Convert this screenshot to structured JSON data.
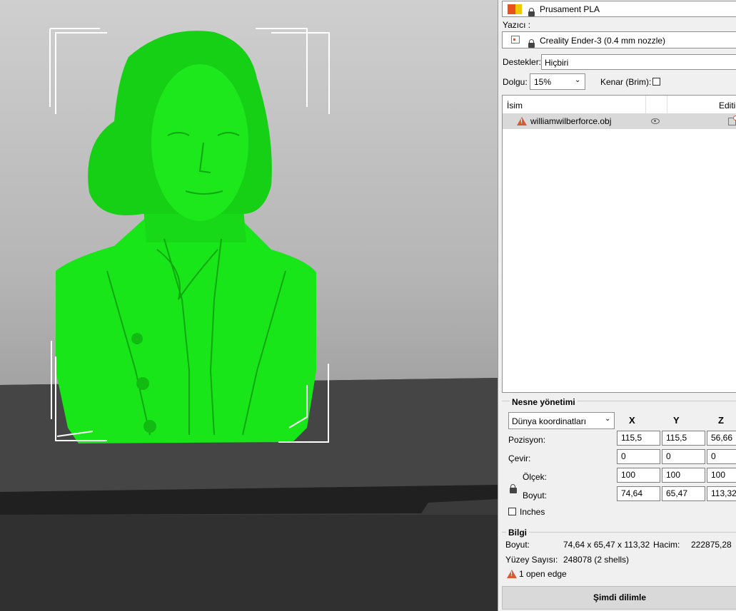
{
  "material": {
    "label": "Prusament PLA",
    "swatch_colors": [
      "#e8511c",
      "#f0c800"
    ],
    "icon": "lock-icon"
  },
  "printer": {
    "section_label": "Yazıcı :",
    "value": "Creality Ender-3 (0.4 mm nozzle)",
    "icon": "printer-icon"
  },
  "supports": {
    "label": "Destekler:",
    "value": "Hiçbiri"
  },
  "infill": {
    "label": "Dolgu:",
    "value": "15%"
  },
  "brim": {
    "label": "Kenar (Brim):",
    "checked": false
  },
  "object_list": {
    "columns": [
      "İsim",
      "Editin"
    ],
    "items": [
      {
        "name": "williamwilberforce.obj",
        "warning": true,
        "visible": true
      }
    ]
  },
  "object_manipulation": {
    "title": "Nesne yönetimi",
    "coord_system": "Dünya koordinatları",
    "axes": [
      "X",
      "Y",
      "Z"
    ],
    "rows": [
      {
        "label": "Pozisyon:",
        "values": [
          "115,5",
          "115,5",
          "56,66"
        ]
      },
      {
        "label": "Çevir:",
        "values": [
          "0",
          "0",
          "0"
        ]
      },
      {
        "label": "Ölçek:",
        "values": [
          "100",
          "100",
          "100"
        ]
      },
      {
        "label": "Boyut:",
        "values": [
          "74,64",
          "65,47",
          "113,32"
        ]
      }
    ],
    "inches_label": "Inches",
    "inches_checked": false
  },
  "info": {
    "title": "Bilgi",
    "size_label": "Boyut:",
    "size_value": "74,64 x 65,47 x 113,32",
    "volume_label": "Hacim:",
    "volume_value": "222875,28",
    "facets_label": "Yüzey Sayısı:",
    "facets_value": "248078 (2 shells)",
    "warning_text": "1 open edge"
  },
  "slice_button": {
    "label": "Şimdi dilimle"
  },
  "colors": {
    "model": "#19e619",
    "panel_bg": "#f0f0f0",
    "warning": "#d85a34"
  }
}
